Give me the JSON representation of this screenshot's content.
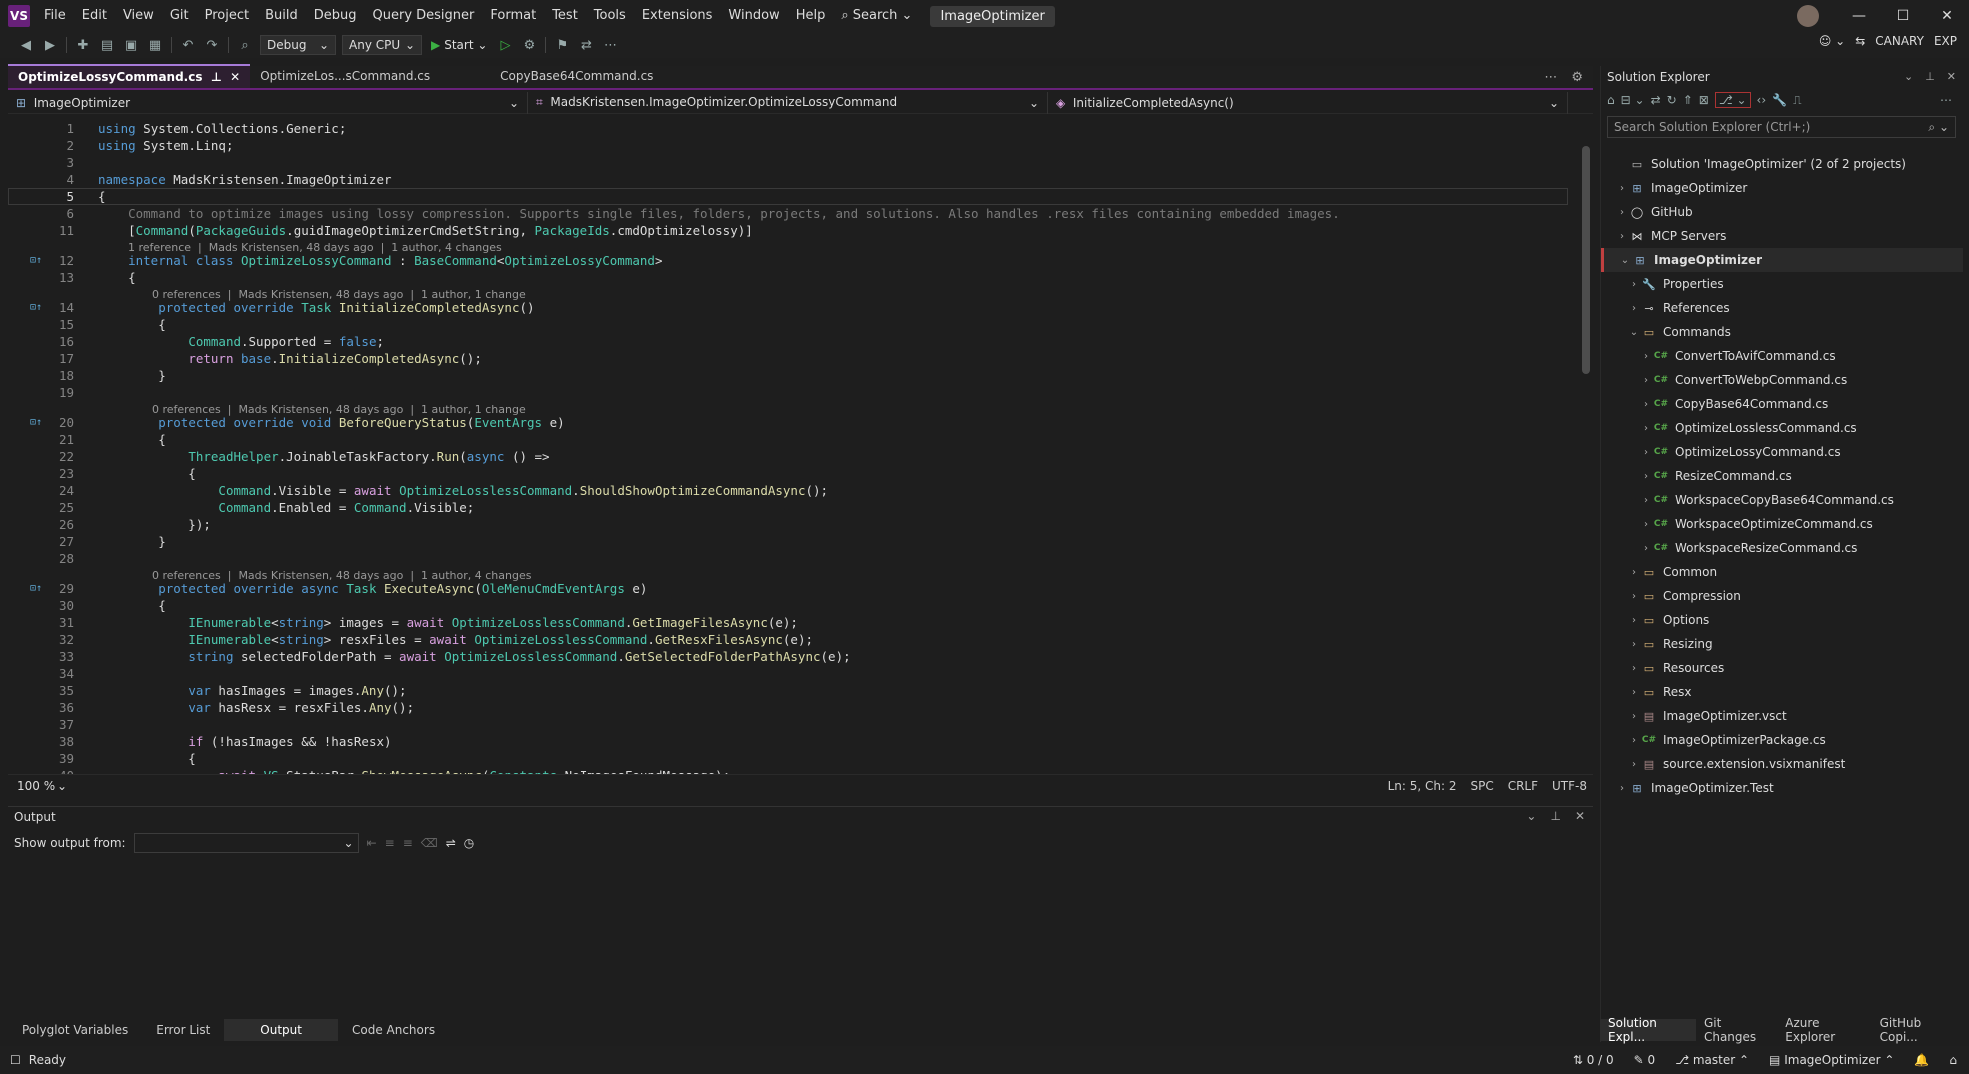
{
  "menu": [
    "File",
    "Edit",
    "View",
    "Git",
    "Project",
    "Build",
    "Debug",
    "Query Designer",
    "Format",
    "Test",
    "Tools",
    "Extensions",
    "Window",
    "Help"
  ],
  "search_label": "Search",
  "window_title": "ImageOptimizer",
  "toolbar": {
    "config": "Debug",
    "platform": "Any CPU",
    "start": "Start"
  },
  "badges": {
    "canary": "CANARY",
    "exp": "EXP"
  },
  "tabs": [
    {
      "label": "OptimizeLossyCommand.cs",
      "active": true
    },
    {
      "label": "OptimizeLos...sCommand.cs",
      "active": false
    },
    {
      "label": "CopyBase64Command.cs",
      "active": false
    }
  ],
  "nav": {
    "project": "ImageOptimizer",
    "type": "MadsKristensen.ImageOptimizer.OptimizeLossyCommand",
    "member": "InitializeCompletedAsync()"
  },
  "code_lines": [
    {
      "n": "1",
      "html": "<span class='kw'>using</span> System.Collections.Generic;"
    },
    {
      "n": "2",
      "html": "<span class='kw'>using</span> System.Linq;"
    },
    {
      "n": "3",
      "html": ""
    },
    {
      "n": "4",
      "html": "<span class='kw'>namespace</span> MadsKristensen.ImageOptimizer"
    },
    {
      "n": "5",
      "html": "{"
    },
    {
      "n": "6",
      "html": "    <span class='cm'>Command to optimize images using lossy compression. Supports single files, folders, projects, and solutions. Also handles .resx files containing embedded images.</span>"
    },
    {
      "n": "11",
      "html": "    [<span class='ty'>Command</span>(<span class='ty'>PackageGuids</span>.guidImageOptimizerCmdSetString, <span class='ty'>PackageIds</span>.cmdOptimizelossy)]"
    },
    {
      "n": "12",
      "html": "    <span class='kw'>internal class</span> <span class='ty'>OptimizeLossyCommand</span> : <span class='ty'>BaseCommand</span>&lt;<span class='ty'>OptimizeLossyCommand</span>&gt;"
    },
    {
      "n": "13",
      "html": "    {"
    },
    {
      "n": "14",
      "html": "        <span class='kw'>protected override</span> <span class='ty'>Task</span> <span class='mt'>InitializeCompletedAsync</span>()"
    },
    {
      "n": "15",
      "html": "        {"
    },
    {
      "n": "16",
      "html": "            <span class='ty'>Command</span>.Supported = <span class='kw'>false</span>;"
    },
    {
      "n": "17",
      "html": "            <span class='ctl'>return</span> <span class='kw'>base</span>.<span class='mt'>InitializeCompletedAsync</span>();"
    },
    {
      "n": "18",
      "html": "        }"
    },
    {
      "n": "19",
      "html": ""
    },
    {
      "n": "20",
      "html": "        <span class='kw'>protected override void</span> <span class='mt'>BeforeQueryStatus</span>(<span class='ty'>EventArgs</span> e)"
    },
    {
      "n": "21",
      "html": "        {"
    },
    {
      "n": "22",
      "html": "            <span class='ty'>ThreadHelper</span>.JoinableTaskFactory.<span class='mt'>Run</span>(<span class='kw'>async</span> () =&gt;"
    },
    {
      "n": "23",
      "html": "            {"
    },
    {
      "n": "24",
      "html": "                <span class='ty'>Command</span>.Visible = <span class='ctl'>await</span> <span class='ty'>OptimizeLosslessCommand</span>.<span class='mt'>ShouldShowOptimizeCommandAsync</span>();"
    },
    {
      "n": "25",
      "html": "                <span class='ty'>Command</span>.Enabled = <span class='ty'>Command</span>.Visible;"
    },
    {
      "n": "26",
      "html": "            });"
    },
    {
      "n": "27",
      "html": "        }"
    },
    {
      "n": "28",
      "html": ""
    },
    {
      "n": "29",
      "html": "        <span class='kw'>protected override async</span> <span class='ty'>Task</span> <span class='mt'>ExecuteAsync</span>(<span class='ty'>OleMenuCmdEventArgs</span> e)"
    },
    {
      "n": "30",
      "html": "        {"
    },
    {
      "n": "31",
      "html": "            <span class='ty'>IEnumerable</span>&lt;<span class='kw'>string</span>&gt; images = <span class='ctl'>await</span> <span class='ty'>OptimizeLosslessCommand</span>.<span class='mt'>GetImageFilesAsync</span>(e);"
    },
    {
      "n": "32",
      "html": "            <span class='ty'>IEnumerable</span>&lt;<span class='kw'>string</span>&gt; resxFiles = <span class='ctl'>await</span> <span class='ty'>OptimizeLosslessCommand</span>.<span class='mt'>GetResxFilesAsync</span>(e);"
    },
    {
      "n": "33",
      "html": "            <span class='kw'>string</span> selectedFolderPath = <span class='ctl'>await</span> <span class='ty'>OptimizeLosslessCommand</span>.<span class='mt'>GetSelectedFolderPathAsync</span>(e);"
    },
    {
      "n": "34",
      "html": ""
    },
    {
      "n": "35",
      "html": "            <span class='kw'>var</span> hasImages = images.<span class='mt'>Any</span>();"
    },
    {
      "n": "36",
      "html": "            <span class='kw'>var</span> hasResx = resxFiles.<span class='mt'>Any</span>();"
    },
    {
      "n": "37",
      "html": ""
    },
    {
      "n": "38",
      "html": "            <span class='ctl'>if</span> (!hasImages &amp;&amp; !hasResx)"
    },
    {
      "n": "39",
      "html": "            {"
    },
    {
      "n": "40",
      "html": "                <span class='ctl'>await</span> <span class='ty'>VS</span>.StatusBar.<span class='mt'>ShowMessageAsync</span>(<span class='ty'>Constants</span>.NoImagesFoundMessage);"
    }
  ],
  "lenses": [
    "1 reference  |  Mads Kristensen, 48 days ago  |  1 author, 4 changes",
    "0 references  |  Mads Kristensen, 48 days ago  |  1 author, 1 change",
    "0 references  |  Mads Kristensen, 48 days ago  |  1 author, 1 change",
    "0 references  |  Mads Kristensen, 48 days ago  |  1 author, 4 changes"
  ],
  "editor_status": {
    "zoom": "100 %",
    "position": "Ln: 5, Ch: 2",
    "spc": "SPC",
    "eol": "CRLF",
    "encoding": "UTF-8"
  },
  "output": {
    "title": "Output",
    "show_from": "Show output from:"
  },
  "bottom_tabs": [
    "Polyglot Variables",
    "Error List",
    "Output",
    "Code Anchors"
  ],
  "solution": {
    "title": "Solution Explorer",
    "search_placeholder": "Search Solution Explorer (Ctrl+;)",
    "items": [
      {
        "label": "Solution 'ImageOptimizer' (2 of 2 projects)",
        "indent": 0,
        "arrow": "",
        "icon": "sln"
      },
      {
        "label": "ImageOptimizer",
        "indent": 0,
        "arrow": "›",
        "icon": "proj"
      },
      {
        "label": "GitHub",
        "indent": 0,
        "arrow": "›",
        "icon": "github"
      },
      {
        "label": "MCP Servers",
        "indent": 0,
        "arrow": "›",
        "icon": "mcp"
      },
      {
        "label": "ImageOptimizer",
        "indent": 0,
        "arrow": "⌄",
        "icon": "proj",
        "selected": true
      },
      {
        "label": "Properties",
        "indent": 1,
        "arrow": "›",
        "icon": "wrench"
      },
      {
        "label": "References",
        "indent": 1,
        "arrow": "›",
        "icon": "refs"
      },
      {
        "label": "Commands",
        "indent": 1,
        "arrow": "⌄",
        "icon": "folder"
      },
      {
        "label": "ConvertToAvifCommand.cs",
        "indent": 2,
        "arrow": "›",
        "icon": "cs"
      },
      {
        "label": "ConvertToWebpCommand.cs",
        "indent": 2,
        "arrow": "›",
        "icon": "cs"
      },
      {
        "label": "CopyBase64Command.cs",
        "indent": 2,
        "arrow": "›",
        "icon": "cs"
      },
      {
        "label": "OptimizeLosslessCommand.cs",
        "indent": 2,
        "arrow": "›",
        "icon": "cs"
      },
      {
        "label": "OptimizeLossyCommand.cs",
        "indent": 2,
        "arrow": "›",
        "icon": "cs"
      },
      {
        "label": "ResizeCommand.cs",
        "indent": 2,
        "arrow": "›",
        "icon": "cs"
      },
      {
        "label": "WorkspaceCopyBase64Command.cs",
        "indent": 2,
        "arrow": "›",
        "icon": "cs"
      },
      {
        "label": "WorkspaceOptimizeCommand.cs",
        "indent": 2,
        "arrow": "›",
        "icon": "cs"
      },
      {
        "label": "WorkspaceResizeCommand.cs",
        "indent": 2,
        "arrow": "›",
        "icon": "cs"
      },
      {
        "label": "Common",
        "indent": 1,
        "arrow": "›",
        "icon": "folder"
      },
      {
        "label": "Compression",
        "indent": 1,
        "arrow": "›",
        "icon": "folder"
      },
      {
        "label": "Options",
        "indent": 1,
        "arrow": "›",
        "icon": "folder"
      },
      {
        "label": "Resizing",
        "indent": 1,
        "arrow": "›",
        "icon": "folder"
      },
      {
        "label": "Resources",
        "indent": 1,
        "arrow": "›",
        "icon": "folder"
      },
      {
        "label": "Resx",
        "indent": 1,
        "arrow": "›",
        "icon": "folder"
      },
      {
        "label": "ImageOptimizer.vsct",
        "indent": 1,
        "arrow": "›",
        "icon": "file"
      },
      {
        "label": "ImageOptimizerPackage.cs",
        "indent": 1,
        "arrow": "›",
        "icon": "cs"
      },
      {
        "label": "source.extension.vsixmanifest",
        "indent": 1,
        "arrow": "›",
        "icon": "file"
      },
      {
        "label": "ImageOptimizer.Test",
        "indent": 0,
        "arrow": "›",
        "icon": "proj"
      }
    ],
    "bottom_tabs": [
      "Solution Expl...",
      "Git Changes",
      "Azure Explorer",
      "GitHub Copi..."
    ]
  },
  "statusbar": {
    "ready": "Ready",
    "sync": "0 / 0",
    "edits": "0",
    "branch": "master",
    "repo": "ImageOptimizer"
  }
}
